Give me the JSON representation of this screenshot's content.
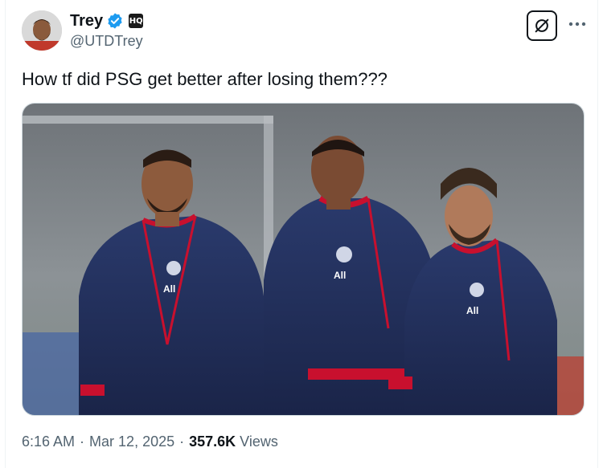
{
  "author": {
    "display_name": "Trey",
    "handle": "@UTDTrey",
    "affiliation_badge": "HQ",
    "verified_color": "#1d9bf0"
  },
  "tweet": {
    "text": "How tf did PSG get better after losing them???"
  },
  "media": {
    "alt_sponsor_text": "All",
    "kit_color": "#1e2a52",
    "trim_color": "#c8102e"
  },
  "meta": {
    "time": "6:16 AM",
    "separator": "·",
    "date": "Mar 12, 2025",
    "views_count": "357.6K",
    "views_label": "Views"
  },
  "icons": {
    "grok": "grok-icon",
    "more": "more-icon",
    "verified": "verified-badge-icon"
  }
}
